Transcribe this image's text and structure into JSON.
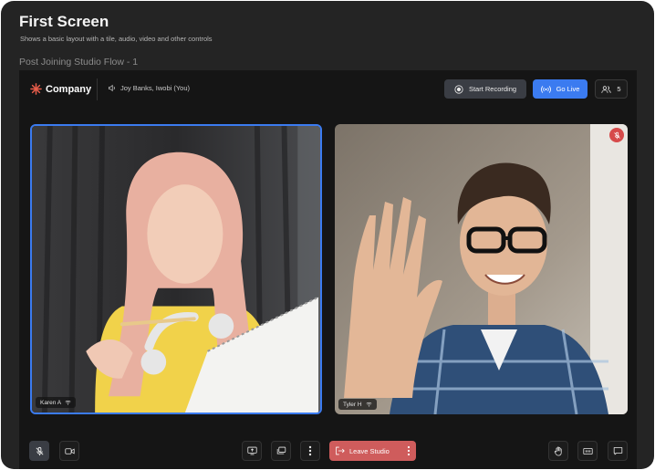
{
  "header": {
    "title": "First Screen",
    "subtitle": "Shows a basic layout with a tile, audio, video and other controls",
    "flow_label": "Post Joining Studio Flow - 1"
  },
  "studio": {
    "brand": "Company",
    "speaking": "Joy Banks, Iwobi (You)",
    "record_label": "Start Recording",
    "live_label": "Go Live",
    "participant_count": "5",
    "colors": {
      "accent": "#3b7bf0",
      "danger": "#cf5c5c",
      "brand_icon": "#e85d4a"
    }
  },
  "tiles": [
    {
      "name": "Karen A",
      "active_speaker": true,
      "muted": false
    },
    {
      "name": "Tyler H",
      "active_speaker": false,
      "muted": true
    }
  ],
  "controls": {
    "leave_label": "Leave Studio",
    "icons": [
      "mic-off-icon",
      "camera-icon",
      "screen-share-icon",
      "layout-icon",
      "more-icon",
      "raise-hand-icon",
      "captions-icon",
      "chat-icon"
    ]
  }
}
